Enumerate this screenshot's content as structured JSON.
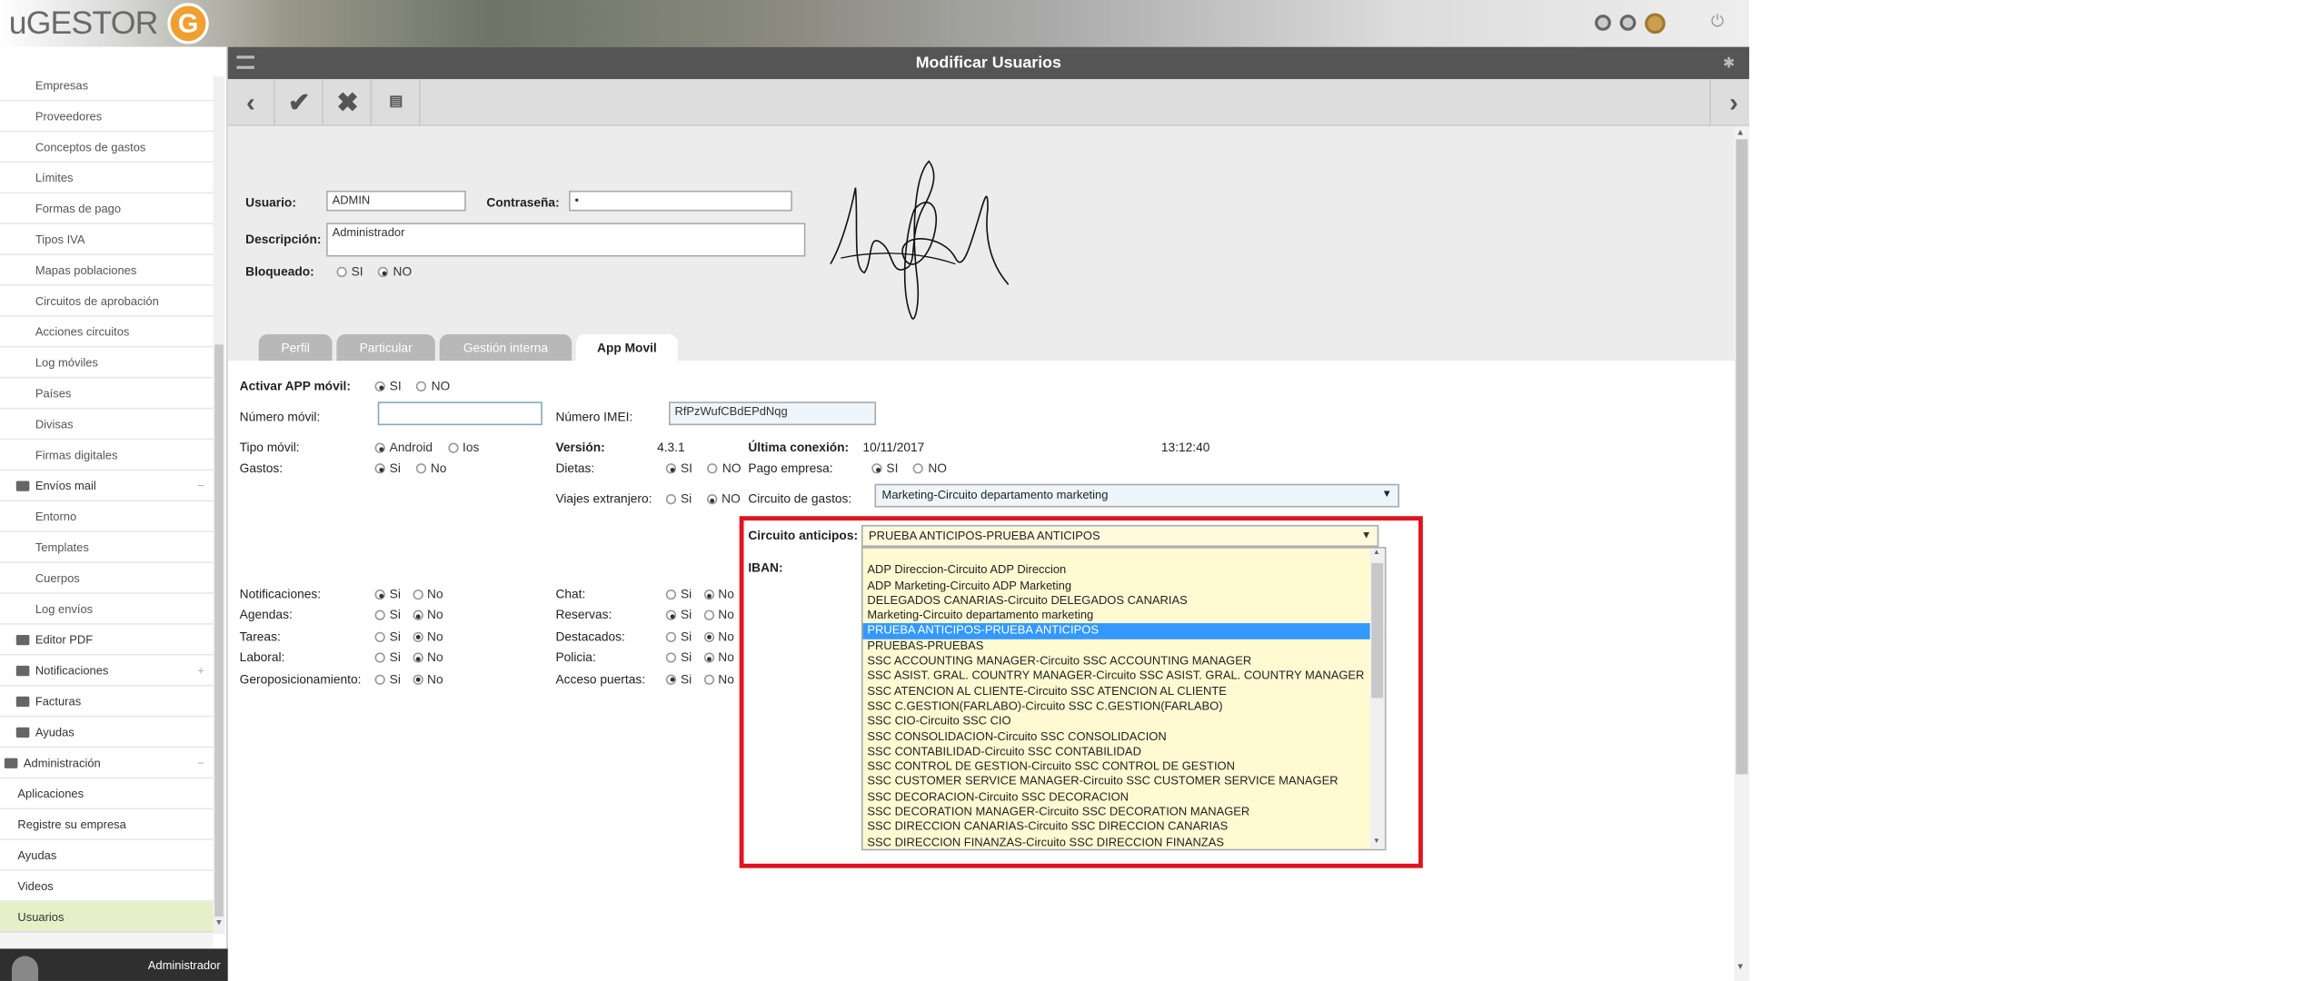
{
  "app": {
    "logo_text": "uGESTOR",
    "logo_letter": "G",
    "page_title": "Modificar Usuarios",
    "user": "Administrador"
  },
  "sidebar": {
    "items": [
      {
        "label": "Empresas",
        "kind": "child"
      },
      {
        "label": "Proveedores",
        "kind": "child"
      },
      {
        "label": "Conceptos de gastos",
        "kind": "child"
      },
      {
        "label": "Límites",
        "kind": "child"
      },
      {
        "label": "Formas de pago",
        "kind": "child"
      },
      {
        "label": "Tipos IVA",
        "kind": "child"
      },
      {
        "label": "Mapas poblaciones",
        "kind": "child"
      },
      {
        "label": "Circuitos de aprobación",
        "kind": "child"
      },
      {
        "label": "Acciones circuitos",
        "kind": "child"
      },
      {
        "label": "Log móviles",
        "kind": "child"
      },
      {
        "label": "Países",
        "kind": "child"
      },
      {
        "label": "Divisas",
        "kind": "child"
      },
      {
        "label": "Firmas digitales",
        "kind": "child"
      },
      {
        "label": "Envíos mail",
        "kind": "folder",
        "sign": "−"
      },
      {
        "label": "Entorno",
        "kind": "child"
      },
      {
        "label": "Templates",
        "kind": "child"
      },
      {
        "label": "Cuerpos",
        "kind": "child"
      },
      {
        "label": "Log envíos",
        "kind": "child"
      },
      {
        "label": "Editor PDF",
        "kind": "folder"
      },
      {
        "label": "Notificaciones",
        "kind": "folder",
        "sign": "+"
      },
      {
        "label": "Facturas",
        "kind": "folder"
      },
      {
        "label": "Ayudas",
        "kind": "folder"
      },
      {
        "label": "Administración",
        "kind": "root",
        "sign": "−"
      },
      {
        "label": "Aplicaciones",
        "kind": "top"
      },
      {
        "label": "Registre su empresa",
        "kind": "top"
      },
      {
        "label": "Ayudas",
        "kind": "top"
      },
      {
        "label": "Videos",
        "kind": "top"
      },
      {
        "label": "Usuarios",
        "kind": "top",
        "active": true
      }
    ]
  },
  "form": {
    "usuario_label": "Usuario:",
    "usuario_value": "ADMIN",
    "password_label": "Contraseña:",
    "password_value": "•",
    "descripcion_label": "Descripción:",
    "descripcion_value": "Administrador",
    "bloqueado_label": "Bloqueado:",
    "bloqueado_options": [
      "SI",
      "NO"
    ],
    "bloqueado_selected": "NO"
  },
  "tabs": [
    "Perfil",
    "Particular",
    "Gestión interna",
    "App Movil"
  ],
  "active_tab": "App Movil",
  "app_movil": {
    "activar_label": "Activar APP móvil:",
    "activar_si": "SI",
    "activar_no": "NO",
    "numero_movil_label": "Número móvil:",
    "numero_movil_value": "",
    "imei_label": "Número IMEI:",
    "imei_value": "RfPzWufCBdEPdNqg",
    "tipo_movil_label": "Tipo móvil:",
    "tipo_android": "Android",
    "tipo_ios": "Ios",
    "version_label": "Versión:",
    "version_value": "4.3.1",
    "ultima_label": "Última conexión:",
    "ultima_fecha": "10/11/2017",
    "ultima_hora": "13:12:40",
    "gastos_label": "Gastos:",
    "dietas_label": "Dietas:",
    "pago_empresa_label": "Pago empresa:",
    "viajes_label": "Viajes extranjero:",
    "circuito_gastos_label": "Circuito de gastos:",
    "circuito_gastos_value": "Marketing-Circuito departamento marketing",
    "circuito_anticipos_label": "Circuito anticipos:",
    "circuito_anticipos_value": "PRUEBA ANTICIPOS-PRUEBA ANTICIPOS",
    "iban_label": "IBAN:",
    "si": "Si",
    "no": "No",
    "SI": "SI",
    "NO": "NO",
    "left_toggles": [
      {
        "label": "Notificaciones:",
        "on": "si"
      },
      {
        "label": "Agendas:",
        "on": "no"
      },
      {
        "label": "Tareas:",
        "on": "no"
      },
      {
        "label": "Laboral:",
        "on": "no"
      },
      {
        "label": "Geroposicionamiento:",
        "on": "no"
      }
    ],
    "right_toggles": [
      {
        "label": "Chat:",
        "on": "no"
      },
      {
        "label": "Reservas:",
        "on": "si"
      },
      {
        "label": "Destacados:",
        "on": "no"
      },
      {
        "label": "Policia:",
        "on": "no"
      },
      {
        "label": "Acceso puertas:",
        "on": "si"
      }
    ]
  },
  "anticipos_list": [
    "",
    "ADP Direccion-Circuito ADP Direccion",
    "ADP Marketing-Circuito ADP Marketing",
    "DELEGADOS CANARIAS-Circuito DELEGADOS CANARIAS",
    "Marketing-Circuito departamento marketing",
    "PRUEBA ANTICIPOS-PRUEBA ANTICIPOS",
    "PRUEBAS-PRUEBAS",
    "SSC ACCOUNTING MANAGER-Circuito SSC ACCOUNTING MANAGER",
    "SSC ASIST. GRAL. COUNTRY MANAGER-Circuito SSC ASIST. GRAL. COUNTRY MANAGER",
    "SSC ATENCION AL CLIENTE-Circuito SSC ATENCION AL CLIENTE",
    "SSC C.GESTION(FARLABO)-Circuito SSC C.GESTION(FARLABO)",
    "SSC CIO-Circuito SSC CIO",
    "SSC CONSOLIDACION-Circuito SSC CONSOLIDACION",
    "SSC CONTABILIDAD-Circuito SSC CONTABILIDAD",
    "SSC CONTROL DE GESTION-Circuito SSC CONTROL DE GESTION",
    "SSC CUSTOMER SERVICE MANAGER-Circuito SSC CUSTOMER SERVICE MANAGER",
    "SSC DECORACION-Circuito SSC DECORACION",
    "SSC DECORATION MANAGER-Circuito SSC DECORATION MANAGER",
    "SSC DIRECCION CANARIAS-Circuito SSC DIRECCION CANARIAS",
    "SSC DIRECCION FINANZAS-Circuito SSC DIRECCION FINANZAS"
  ],
  "anticipos_highlight_index": 5,
  "colors": {
    "highlight": "#3399ff",
    "annotation": "#e0141e",
    "active_menu": "#e6f0c8"
  }
}
